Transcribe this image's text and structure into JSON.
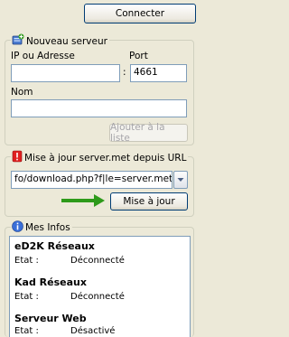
{
  "connect_label": "Connecter",
  "new_server": {
    "title": "Nouveau serveur",
    "ip_label": "IP ou Adresse",
    "port_label": "Port",
    "ip_value": "",
    "port_value": "4661",
    "separator": ":",
    "name_label": "Nom",
    "name_value": "",
    "add_label": "Ajouter à la liste"
  },
  "update": {
    "title": "Mise à jour server.met depuis URL",
    "url_value": "fo/download.php?f|le=server.met",
    "update_label": "Mise à jour"
  },
  "infos": {
    "title": "Mes Infos",
    "sections": [
      {
        "title": "eD2K Réseaux",
        "key": "Etat :",
        "value": "Déconnecté"
      },
      {
        "title": "Kad Réseaux",
        "key": "Etat :",
        "value": "Déconnecté"
      },
      {
        "title": "Serveur Web",
        "key": "Etat :",
        "value": "Désactivé"
      }
    ]
  },
  "colors": {
    "accent_arrow": "#2e9a1a",
    "input_border": "#7f9db9",
    "button_border": "#003c74"
  }
}
